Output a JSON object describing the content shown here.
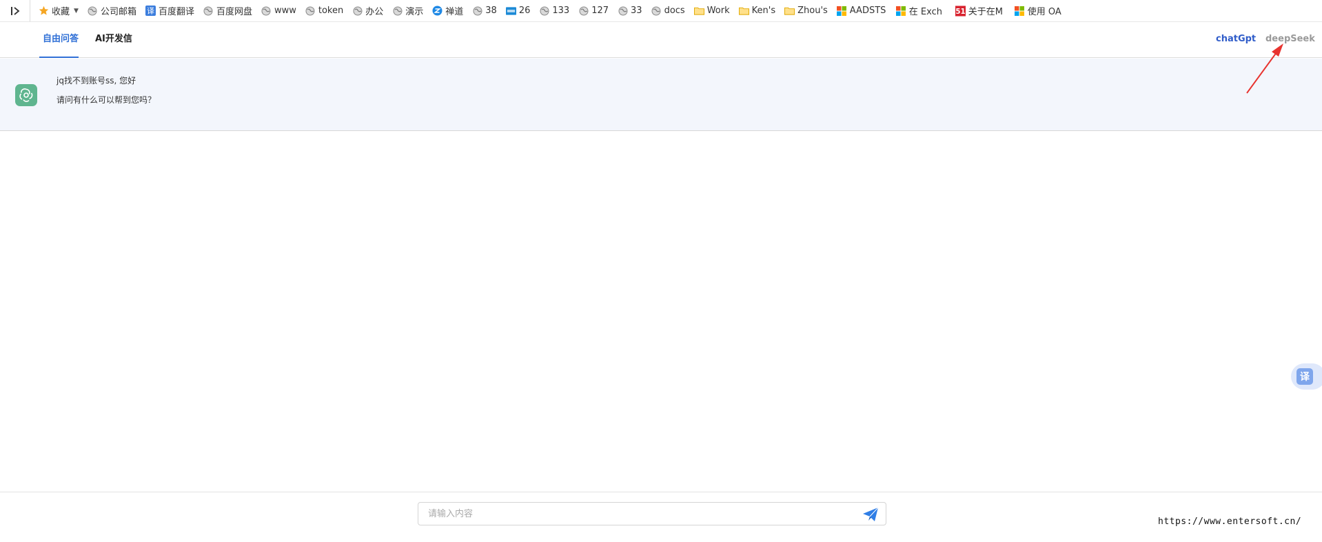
{
  "bookmarks": {
    "items": [
      {
        "label": "收藏",
        "icon": "star-icon"
      },
      {
        "label": "公司邮箱",
        "icon": "globe-icon"
      },
      {
        "label": "百度翻译",
        "icon": "translate-icon"
      },
      {
        "label": "百度网盘",
        "icon": "globe-icon"
      },
      {
        "label": "www",
        "icon": "globe-icon"
      },
      {
        "label": "token",
        "icon": "globe-icon"
      },
      {
        "label": "办公",
        "icon": "globe-icon"
      },
      {
        "label": "演示",
        "icon": "globe-icon"
      },
      {
        "label": "禅道",
        "icon": "zentao-icon"
      },
      {
        "label": "38",
        "icon": "globe-icon"
      },
      {
        "label": "26",
        "icon": "site-icon"
      },
      {
        "label": "133",
        "icon": "globe-icon"
      },
      {
        "label": "127",
        "icon": "globe-icon"
      },
      {
        "label": "33",
        "icon": "globe-icon"
      },
      {
        "label": "docs",
        "icon": "globe-icon"
      },
      {
        "label": "Work",
        "icon": "folder-icon"
      },
      {
        "label": "Ken's",
        "icon": "folder-icon"
      },
      {
        "label": "Zhou's",
        "icon": "folder-icon"
      },
      {
        "label": "AADSTS",
        "icon": "microsoft-icon"
      },
      {
        "label": "在 Exch",
        "icon": "microsoft-icon"
      },
      {
        "label": "关于在M",
        "icon": "51cto-icon"
      },
      {
        "label": "使用 OA",
        "icon": "microsoft-icon"
      }
    ]
  },
  "header": {
    "tabs": [
      {
        "label": "自由问答",
        "active": true
      },
      {
        "label": "AI开发信",
        "active": false
      }
    ],
    "models": [
      {
        "label": "chatGpt",
        "selected": true
      },
      {
        "label": "deepSeek",
        "selected": false
      }
    ]
  },
  "greeting": {
    "line1": "jq找不到账号ss, 您好",
    "line2": "请问有什么可以帮到您吗？",
    "avatar_icon": "openai-icon"
  },
  "floating": {
    "translate_label": "译"
  },
  "composer": {
    "placeholder": "请输入内容",
    "value": "",
    "send_icon": "send-icon"
  },
  "watermark": "https://www.entersoft.cn/",
  "colors": {
    "accent": "#2f6fd6",
    "avatar": "#5fb58f",
    "panel_bg": "#f3f6fc",
    "annotation": "#e8332f"
  }
}
